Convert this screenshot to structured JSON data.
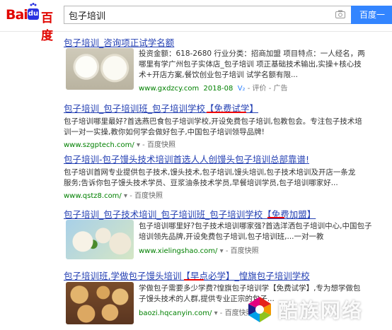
{
  "header": {
    "logo_text_left": "Bai",
    "logo_text_du": "du",
    "logo_text_right": "百度",
    "search_value": "包子培训",
    "search_button": "百度一"
  },
  "results": [
    {
      "title": "包子培训_咨询项正试学名额",
      "abstract_1": "投资金额：618-2680    行业分类：招商加盟    项目特点：一人经名，两",
      "abstract_2": "哪里有学广州包子实体店_包子培训 项正基础技术输出,实操+核心技",
      "abstract_3": "术+开店方案,餐饮创业包子培训 试学名额有限...",
      "url": "www.gxdzcy.com",
      "date": "2018-08",
      "vlabel": "V₂",
      "rating": "评价",
      "ad": "广告"
    },
    {
      "title": "包子培训_包子培训班_包子培训学校【免费试学】",
      "abstract_1": "包子培训哪里最好?首选燕巴食包子培训学校,开设免费包子培训,包教包会。专注包子技术培",
      "abstract_2": "训一对一实操,教你如何学会做好包子,中国包子培训领导品牌!",
      "url": "www.szgptech.com/",
      "snapshot": "百度快照"
    },
    {
      "title": "包子培训-包子馒头技术培训首选人人创馒头包子培训总部靠谱!",
      "abstract_1": "包子培训首网专业提供包子技术,馒头技术,包子培训,馒头培训,包子技术培训及开店一条龙",
      "abstract_2": "服务;告诉你包子馒头技术学员、豆浆油条技术学员,早餐培训学员,包子培训哪家好...",
      "url": "www.qstz8.com/",
      "snapshot": "百度快照"
    },
    {
      "title": "包子培训_包子技术培训_包子培训班_包子培训学校【免费加盟】",
      "abstract_1": "包子培训哪里好?包子技术培训哪家强?首选洋洒包子培训中心,中国包子",
      "abstract_2": "培训领先品牌,开设免费包子培训,包子培训班,...一对一教",
      "url": "www.xielingshao.com/",
      "snapshot": "百度快照"
    },
    {
      "title": "包子培训班,学做包子馒头培训【早点必学】_惶旗包子培训学校",
      "abstract_1": "学做包子需要多少学费?惶旗包子培训学【免费试学】,专为想学做包",
      "abstract_2": "子馒头技术的人群,提供专业正宗的包子...",
      "url": "baozi.hqcanyin.com/",
      "snapshot": "百度快照"
    }
  ],
  "watermark": {
    "text": "酷族网络",
    "url": "WWW.COOLZU.COM"
  }
}
